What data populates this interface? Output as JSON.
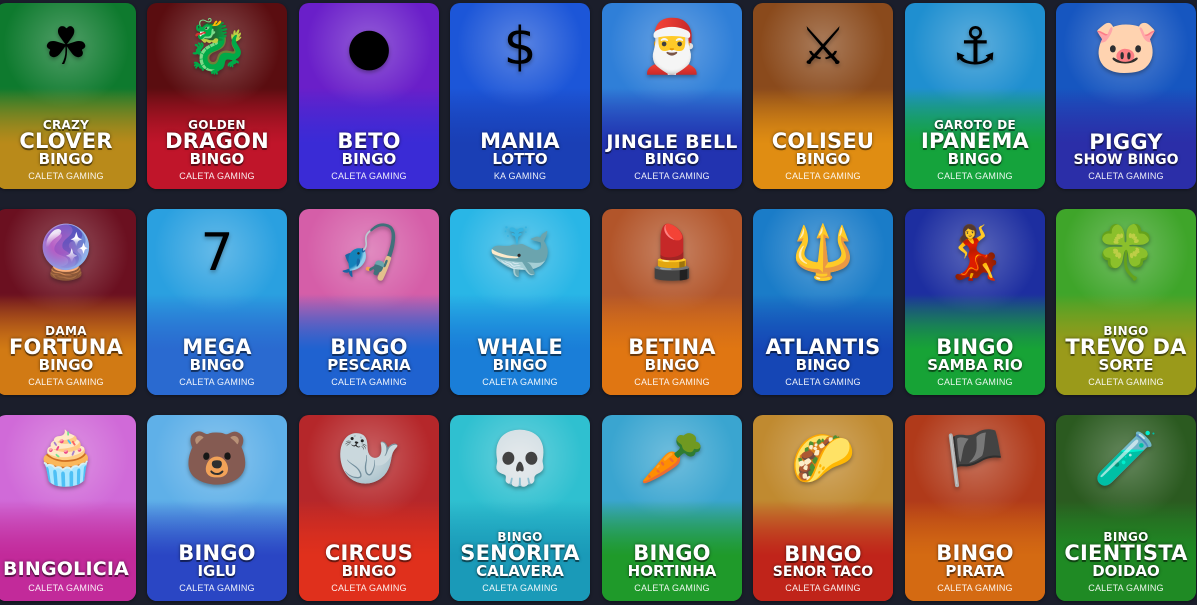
{
  "games": [
    {
      "pre": "CRAZY",
      "main": "CLOVER",
      "sub": "BINGO",
      "provider": "CALETA GAMING",
      "icon": "leprechaun-icon",
      "glyph": "☘",
      "top": "#0e7a2e",
      "bottom": "#b98a1a"
    },
    {
      "pre": "GOLDEN",
      "main": "DRAGON",
      "sub": "BINGO",
      "provider": "CALETA GAMING",
      "icon": "dragon-icon",
      "glyph": "🐉",
      "top": "#5a0d10",
      "bottom": "#c0152a"
    },
    {
      "pre": "",
      "main": "BETO",
      "sub": "BINGO",
      "provider": "CALETA GAMING",
      "icon": "ball-icon",
      "glyph": "●",
      "top": "#6a1fc9",
      "bottom": "#3a2bd6"
    },
    {
      "pre": "",
      "main": "MANIA",
      "sub": "LOTTO",
      "provider": "KA GAMING",
      "icon": "lotto-ball-icon",
      "glyph": "$",
      "top": "#1c56d8",
      "bottom": "#1a3fb5"
    },
    {
      "pre": "",
      "main": "JINGLE BELL",
      "sub": "BINGO",
      "provider": "CALETA GAMING",
      "icon": "santa-icon",
      "glyph": "🎅",
      "top": "#2f7fd8",
      "bottom": "#2233b0"
    },
    {
      "pre": "",
      "main": "COLISEU",
      "sub": "BINGO",
      "provider": "CALETA GAMING",
      "icon": "gladiator-icon",
      "glyph": "⚔",
      "top": "#8a4a1c",
      "bottom": "#e08d12"
    },
    {
      "pre": "GAROTO DE",
      "main": "IPANEMA",
      "sub": "BINGO",
      "provider": "CALETA GAMING",
      "icon": "captain-icon",
      "glyph": "⚓",
      "top": "#1f8fd0",
      "bottom": "#15a33c"
    },
    {
      "pre": "",
      "main": "PIGGY",
      "sub": "SHOW BINGO",
      "provider": "CALETA GAMING",
      "icon": "pig-icon",
      "glyph": "🐷",
      "top": "#1656c0",
      "bottom": "#2b2ea8"
    },
    {
      "pre": "DAMA",
      "main": "FORTUNA",
      "sub": "BINGO",
      "provider": "CALETA GAMING",
      "icon": "crystal-ball-icon",
      "glyph": "🔮",
      "top": "#6b1020",
      "bottom": "#d17a14"
    },
    {
      "pre": "",
      "main": "MEGA",
      "sub": "BINGO",
      "provider": "CALETA GAMING",
      "icon": "bingo-ball-icon",
      "glyph": "7",
      "top": "#2aa0e0",
      "bottom": "#2a6ad0"
    },
    {
      "pre": "",
      "main": "BINGO",
      "sub": "PESCARIA",
      "provider": "CALETA GAMING",
      "icon": "fisherman-icon",
      "glyph": "🎣",
      "top": "#d55ea8",
      "bottom": "#1f62d0"
    },
    {
      "pre": "",
      "main": "WHALE",
      "sub": "BINGO",
      "provider": "CALETA GAMING",
      "icon": "whale-icon",
      "glyph": "🐳",
      "top": "#29b6e6",
      "bottom": "#1a7ed8"
    },
    {
      "pre": "",
      "main": "BETINA",
      "sub": "BINGO",
      "provider": "CALETA GAMING",
      "icon": "woman-icon",
      "glyph": "💄",
      "top": "#b2552a",
      "bottom": "#e07612"
    },
    {
      "pre": "",
      "main": "ATLANTIS",
      "sub": "BINGO",
      "provider": "CALETA GAMING",
      "icon": "poseidon-icon",
      "glyph": "🔱",
      "top": "#1a7cc8",
      "bottom": "#1546b5"
    },
    {
      "pre": "",
      "main": "BINGO",
      "sub": "SAMBA RIO",
      "provider": "CALETA GAMING",
      "icon": "samba-dancer-icon",
      "glyph": "💃",
      "top": "#1d2ea0",
      "bottom": "#17a336"
    },
    {
      "pre": "BINGO",
      "main": "TREVO DA",
      "sub": "SORTE",
      "provider": "CALETA GAMING",
      "icon": "leprechaun-hat-icon",
      "glyph": "🍀",
      "top": "#3fa52a",
      "bottom": "#9a9a1a"
    },
    {
      "pre": "",
      "main": "BINGOLICIA",
      "sub": "",
      "provider": "CALETA GAMING",
      "icon": "chef-icon",
      "glyph": "🧁",
      "top": "#d06ad8",
      "bottom": "#c22a9a"
    },
    {
      "pre": "",
      "main": "BINGO",
      "sub": "IGLU",
      "provider": "CALETA GAMING",
      "icon": "polar-bear-icon",
      "glyph": "🐻",
      "top": "#5fb0e8",
      "bottom": "#2a46c4"
    },
    {
      "pre": "",
      "main": "CIRCUS",
      "sub": "BINGO",
      "provider": "CALETA GAMING",
      "icon": "seal-icon",
      "glyph": "🦭",
      "top": "#b5272a",
      "bottom": "#e0301c"
    },
    {
      "pre": "BINGO",
      "main": "SENORITA",
      "sub": "CALAVERA",
      "provider": "CALETA GAMING",
      "icon": "skull-icon",
      "glyph": "💀",
      "top": "#2fc0d0",
      "bottom": "#1a9ab8"
    },
    {
      "pre": "",
      "main": "BINGO",
      "sub": "HORTINHA",
      "provider": "CALETA GAMING",
      "icon": "carrot-icon",
      "glyph": "🥕",
      "top": "#3aa5d0",
      "bottom": "#1f9a2a"
    },
    {
      "pre": "",
      "main": "BINGO",
      "sub": "SENOR TACO",
      "provider": "CALETA GAMING",
      "icon": "sombrero-icon",
      "glyph": "🌮",
      "top": "#c08a30",
      "bottom": "#c0241a"
    },
    {
      "pre": "",
      "main": "BINGO",
      "sub": "PIRATA",
      "provider": "CALETA GAMING",
      "icon": "pirate-icon",
      "glyph": "🏴",
      "top": "#b03a1a",
      "bottom": "#d46a12"
    },
    {
      "pre": "BINGO",
      "main": "CIENTISTA",
      "sub": "DOIDAO",
      "provider": "CALETA GAMING",
      "icon": "scientist-icon",
      "glyph": "🧪",
      "top": "#2b5a20",
      "bottom": "#1f8a24"
    }
  ]
}
